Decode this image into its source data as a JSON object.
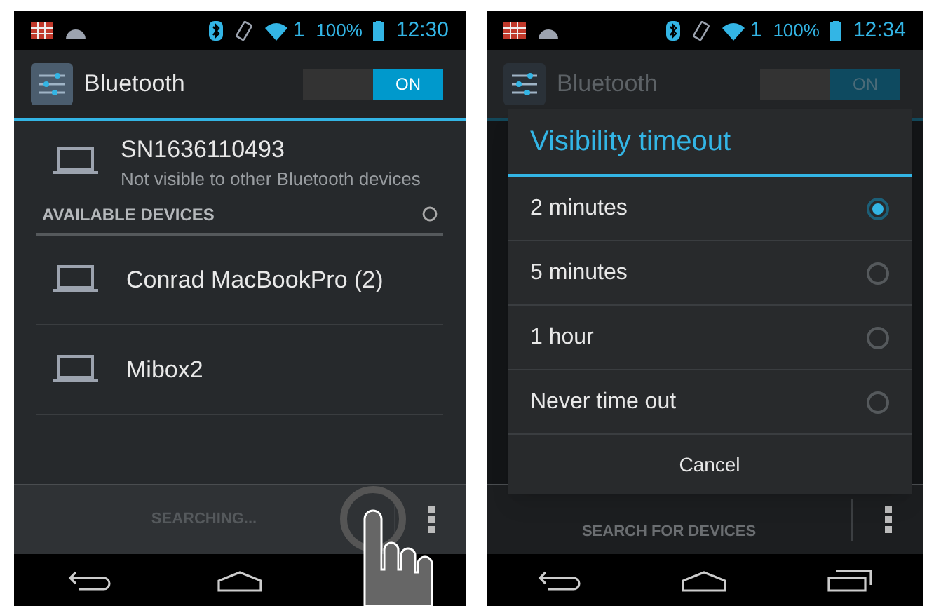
{
  "settings_screen": {
    "status_bar": {
      "signal": "1",
      "battery": "100%",
      "time": "12:30"
    },
    "action_bar": {
      "title": "Bluetooth",
      "toggle": {
        "label": "ON",
        "on": true
      }
    },
    "this_device": {
      "name": "SN1636110493",
      "status": "Not visible to other Bluetooth devices"
    },
    "section_header": "AVAILABLE DEVICES",
    "devices": [
      {
        "name": "Conrad MacBookPro (2)"
      },
      {
        "name": "Mibox2"
      }
    ],
    "bottom_bar": {
      "label": "SEARCHING...",
      "disabled": true
    }
  },
  "dialog_screen": {
    "status_bar": {
      "signal": "1",
      "battery": "100%",
      "time": "12:34"
    },
    "action_bar": {
      "title": "Bluetooth",
      "toggle": {
        "label": "ON",
        "on": true
      }
    },
    "dialog": {
      "title": "Visibility timeout",
      "options": [
        {
          "label": "2 minutes",
          "selected": true
        },
        {
          "label": "5 minutes",
          "selected": false
        },
        {
          "label": "1 hour",
          "selected": false
        },
        {
          "label": "Never time out",
          "selected": false
        }
      ],
      "cancel": "Cancel"
    },
    "bottom_bar": {
      "label": "SEARCH FOR DEVICES"
    }
  }
}
